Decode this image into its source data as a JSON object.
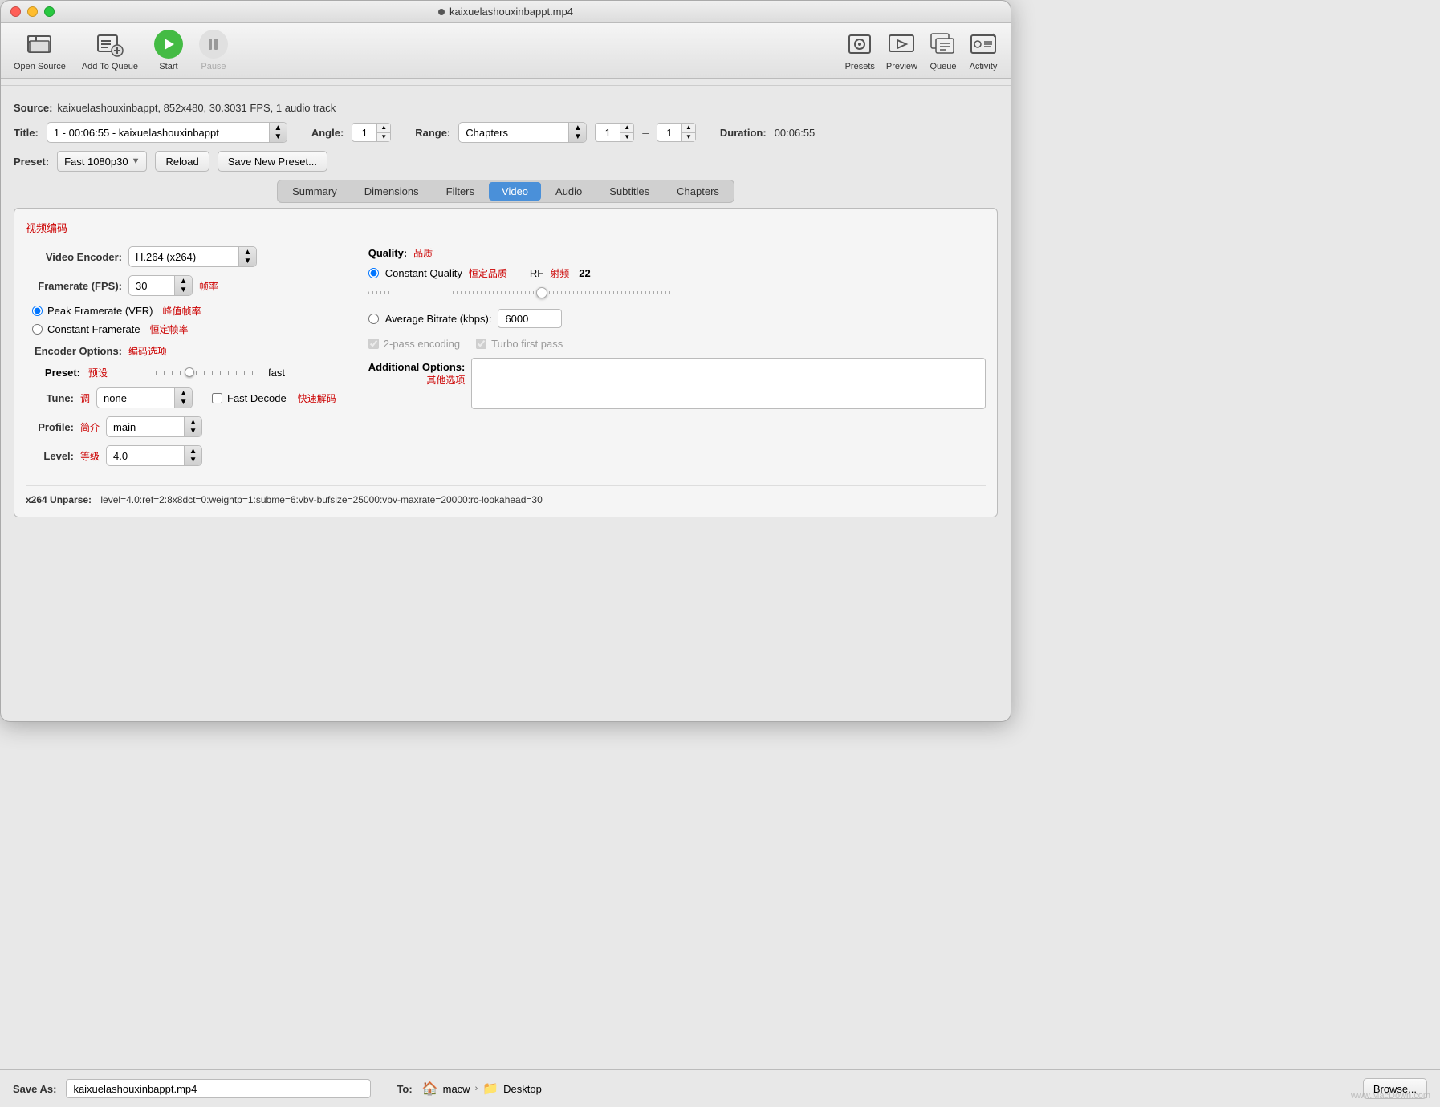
{
  "titlebar": {
    "title": "kaixuelashouxinbappt.mp4"
  },
  "toolbar": {
    "open_source_label": "Open Source",
    "add_to_queue_label": "Add To Queue",
    "start_label": "Start",
    "pause_label": "Pause",
    "presets_label": "Presets",
    "preview_label": "Preview",
    "queue_label": "Queue",
    "activity_label": "Activity"
  },
  "source": {
    "label": "Source:",
    "value": "kaixuelashouxinbappt, 852x480, 30.3031 FPS, 1 audio track"
  },
  "title_field": {
    "label": "Title:",
    "value": "1 - 00:06:55 - kaixuelashouxinbappt"
  },
  "angle": {
    "label": "Angle:",
    "value": "1"
  },
  "range": {
    "label": "Range:",
    "value": "Chapters"
  },
  "range_start": "1",
  "range_end": "1",
  "duration": {
    "label": "Duration:",
    "value": "00:06:55"
  },
  "preset": {
    "label": "Preset:",
    "value": "Fast 1080p30",
    "reload_label": "Reload",
    "save_label": "Save New Preset..."
  },
  "tabs": {
    "items": [
      {
        "label": "Summary",
        "active": false
      },
      {
        "label": "Dimensions",
        "active": false
      },
      {
        "label": "Filters",
        "active": false
      },
      {
        "label": "Video",
        "active": true
      },
      {
        "label": "Audio",
        "active": false
      },
      {
        "label": "Subtitles",
        "active": false
      },
      {
        "label": "Chapters",
        "active": false
      }
    ]
  },
  "video": {
    "section_title_cn": "视频编码",
    "encoder_label": "Video Encoder:",
    "encoder_value": "H.264 (x264)",
    "framerate_label": "Framerate (FPS):",
    "framerate_value": "30",
    "framerate_cn": "帧率",
    "peak_framerate_label": "Peak Framerate (VFR)",
    "peak_framerate_cn": "峰值帧率",
    "constant_framerate_label": "Constant Framerate",
    "constant_framerate_cn": "恒定帧率",
    "quality_label": "Quality:",
    "quality_cn": "品质",
    "constant_quality_label": "Constant Quality",
    "constant_quality_cn": "恒定品质",
    "rf_label": "RF",
    "rf_value": "22",
    "rf_cn": "射频",
    "avg_bitrate_label": "Average Bitrate (kbps):",
    "avg_bitrate_value": "6000",
    "two_pass_label": "2-pass encoding",
    "turbo_first_pass_label": "Turbo first pass",
    "encoder_options_label": "Encoder Options:",
    "encoder_options_cn": "编码选项",
    "preset_label": "Preset:",
    "preset_cn": "预设",
    "preset_value": "fast",
    "tune_label": "Tune:",
    "tune_cn": "调",
    "tune_value": "none",
    "fast_decode_label": "Fast Decode",
    "fast_decode_cn": "快速解码",
    "profile_label": "Profile:",
    "profile_cn": "简介",
    "profile_value": "main",
    "level_label": "Level:",
    "level_cn": "等级",
    "level_value": "4.0",
    "additional_options_label": "Additional Options:",
    "additional_options_cn": "其他选项",
    "unparse_label": "x264 Unparse:",
    "unparse_value": "level=4.0:ref=2:8x8dct=0:weightp=1:subme=6:vbv-bufsize=25000:vbv-maxrate=20000:rc-lookahead=30"
  },
  "bottom": {
    "save_as_label": "Save As:",
    "save_as_value": "kaixuelashouxinbappt.mp4",
    "to_label": "To:",
    "path1": "macw",
    "path2": "Desktop",
    "browse_label": "Browse..."
  },
  "watermark": "www.MacDown.com"
}
